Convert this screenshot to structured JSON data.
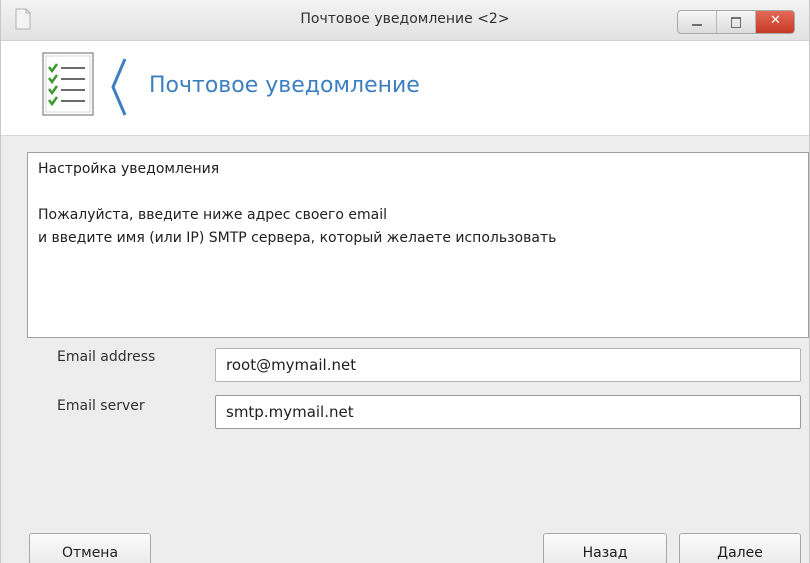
{
  "window": {
    "title": "Почтовое уведомление <2>"
  },
  "banner": {
    "title": "Почтовое уведомление"
  },
  "description": {
    "heading": "Настройка уведомления",
    "line1": "Пожалуйста, введите ниже адрес своего email",
    "line2": "и введите имя (или IP) SMTP сервера, который желаете использовать"
  },
  "form": {
    "email_address": {
      "label": "Email address",
      "value": "root@mymail.net"
    },
    "email_server": {
      "label": "Email server",
      "value": "smtp.mymail.net"
    }
  },
  "buttons": {
    "cancel": "Отмена",
    "back": "Назад",
    "next": "Далее"
  },
  "colors": {
    "accent": "#3d7fc1",
    "close_button": "#c73a25"
  },
  "icons": {
    "app": "document-icon",
    "banner": "checklist-icon"
  }
}
